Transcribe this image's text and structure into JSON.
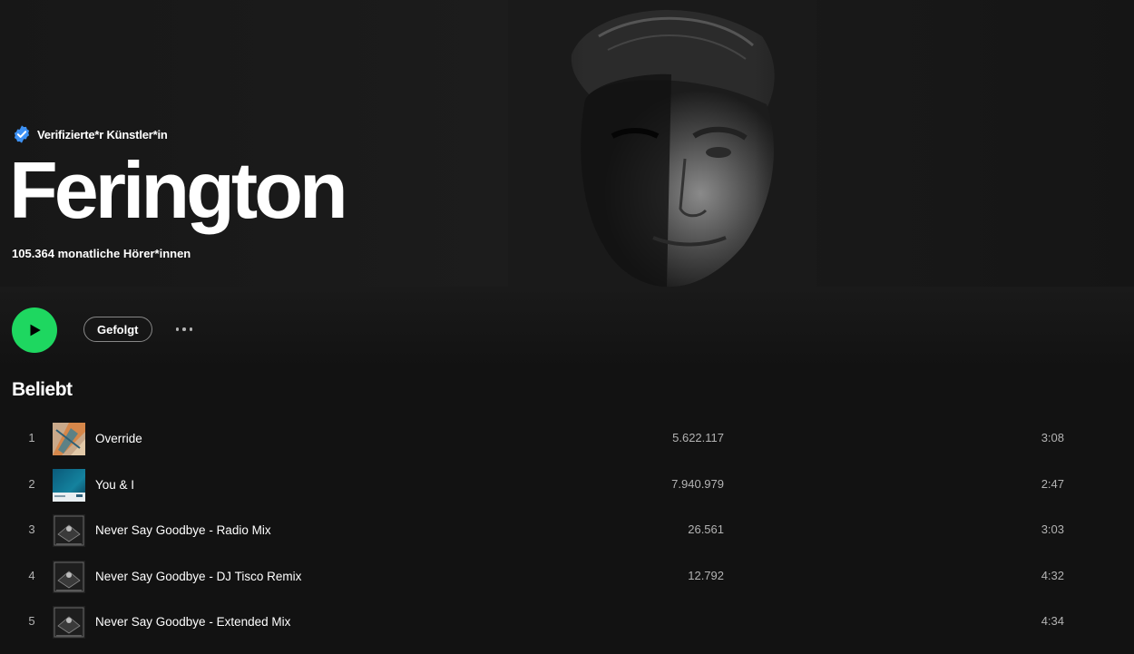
{
  "artist": {
    "verified_label": "Verifizierte*r Künstler*in",
    "name": "Ferington",
    "monthly_listeners": "105.364 monatliche Hörer*innen"
  },
  "actions": {
    "follow_label": "Gefolgt"
  },
  "popular": {
    "title": "Beliebt",
    "tracks": [
      {
        "num": "1",
        "title": "Override",
        "plays": "5.622.117",
        "duration": "3:08",
        "cover": "override-cover"
      },
      {
        "num": "2",
        "title": "You & I",
        "plays": "7.940.979",
        "duration": "2:47",
        "cover": "you-and-i-cover"
      },
      {
        "num": "3",
        "title": "Never Say Goodbye - Radio Mix",
        "plays": "26.561",
        "duration": "3:03",
        "cover": "never-say-goodbye-cover"
      },
      {
        "num": "4",
        "title": "Never Say Goodbye - DJ Tisco Remix",
        "plays": "12.792",
        "duration": "4:32",
        "cover": "never-say-goodbye-cover"
      },
      {
        "num": "5",
        "title": "Never Say Goodbye - Extended Mix",
        "plays": "",
        "duration": "4:34",
        "cover": "never-say-goodbye-cover"
      }
    ]
  },
  "colors": {
    "accent": "#1ed760",
    "verified_badge": "#3d91f4",
    "background": "#121212"
  }
}
